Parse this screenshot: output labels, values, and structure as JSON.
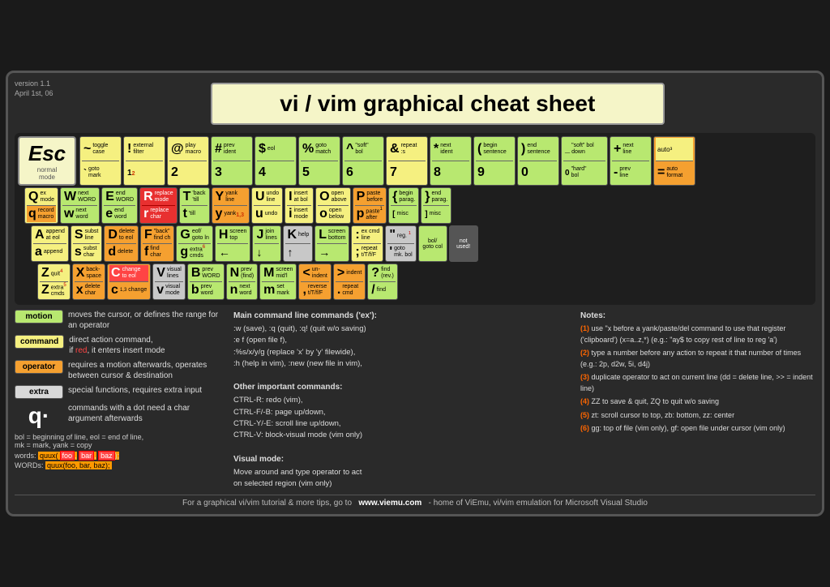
{
  "meta": {
    "version": "version 1.1",
    "date": "April 1st, 06"
  },
  "title": "vi / vim graphical cheat sheet",
  "esc": {
    "key": "Esc",
    "label1": "normal",
    "label2": "mode"
  },
  "legend": {
    "motion": {
      "label": "motion",
      "desc": "moves the cursor, or defines the range for an operator",
      "color": "#b8e870"
    },
    "command": {
      "label": "command",
      "desc": "direct action command, if red, it enters insert mode",
      "color": "#f5f080"
    },
    "operator": {
      "label": "operator",
      "desc": "requires a motion afterwards, operates between cursor & destination",
      "color": "#f5a030"
    },
    "extra": {
      "label": "extra",
      "desc": "special functions, requires extra input",
      "color": "#c8c8c8"
    },
    "dotq": {
      "desc": "commands with a dot need a char argument afterwards"
    }
  },
  "bottom_text": {
    "line1": "bol = beginning of line, eol = end of line, mk = mark, yank = copy",
    "line2": "words:  quux(foo, bar, baz);",
    "line3": "WORDs: quux(foo, bar, baz);"
  },
  "main_commands": {
    "title": "Main command line commands ('ex'):",
    "items": [
      ":w (save), :q (quit), :q! (quit w/o saving)",
      ":e f (open file f),",
      ":%s/x/y/g (replace 'x' by 'y' filewide),",
      ":h (help in vim), :new (new file in vim),",
      "",
      "Other important commands:",
      "CTRL-R: redo (vim),",
      "CTRL-F/-B: page up/down,",
      "CTRL-Y/-E: scroll line up/down,",
      "CTRL-V: block-visual mode (vim only)",
      "",
      "Visual mode:",
      "Move around and type operator to act on selected region (vim only)"
    ]
  },
  "notes": {
    "title": "Notes:",
    "items": [
      "(1) use \"x before a yank/paste/del command to use that register ('clipboard') (x=a..z,*) (e.g.: \"ay$ to copy rest of line to reg 'a')",
      "(2) type a number before any action to repeat it that number of times (e.g.: 2p, d2w, 5i, d4j)",
      "(3) duplicate operator to act on current line (dd = delete line, >> = indent line)",
      "(4) ZZ to save & quit, ZQ to quit w/o saving",
      "(5) zt: scroll cursor to top, zb: bottom, zz: center",
      "(6) gg: top of file (vim only), gf: open file under cursor (vim only)"
    ]
  },
  "footer": "For a graphical vi/vim tutorial & more tips, go to   www.viemu.com  - home of ViEmu, vi/vim emulation for Microsoft Visual Studio"
}
